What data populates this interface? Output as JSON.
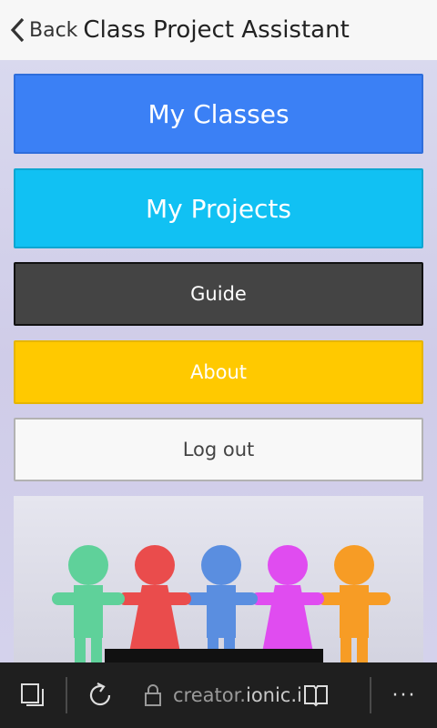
{
  "header": {
    "back_label": "Back",
    "title": "Class Project Assistant"
  },
  "menu": {
    "classes": "My Classes",
    "projects": "My Projects",
    "guide": "Guide",
    "about": "About",
    "logout": "Log out"
  },
  "banner": {
    "figures": [
      {
        "color": "#5fd19a"
      },
      {
        "color": "#ea4c4c"
      },
      {
        "color": "#5a8ee0"
      },
      {
        "color": "#e04cf0"
      },
      {
        "color": "#f79c25"
      }
    ]
  },
  "browser": {
    "url_prefix": "creator.",
    "url_main": "ionic.ic",
    "more_label": "···",
    "tabs_icon": "tabs-icon",
    "refresh_icon": "refresh-icon",
    "lock_icon": "lock-icon",
    "reading_icon": "reading-view-icon"
  },
  "colors": {
    "classes": "#3b80f5",
    "projects": "#11c1f3",
    "guide": "#444444",
    "about": "#ffc900",
    "logout": "#f8f8f8"
  }
}
